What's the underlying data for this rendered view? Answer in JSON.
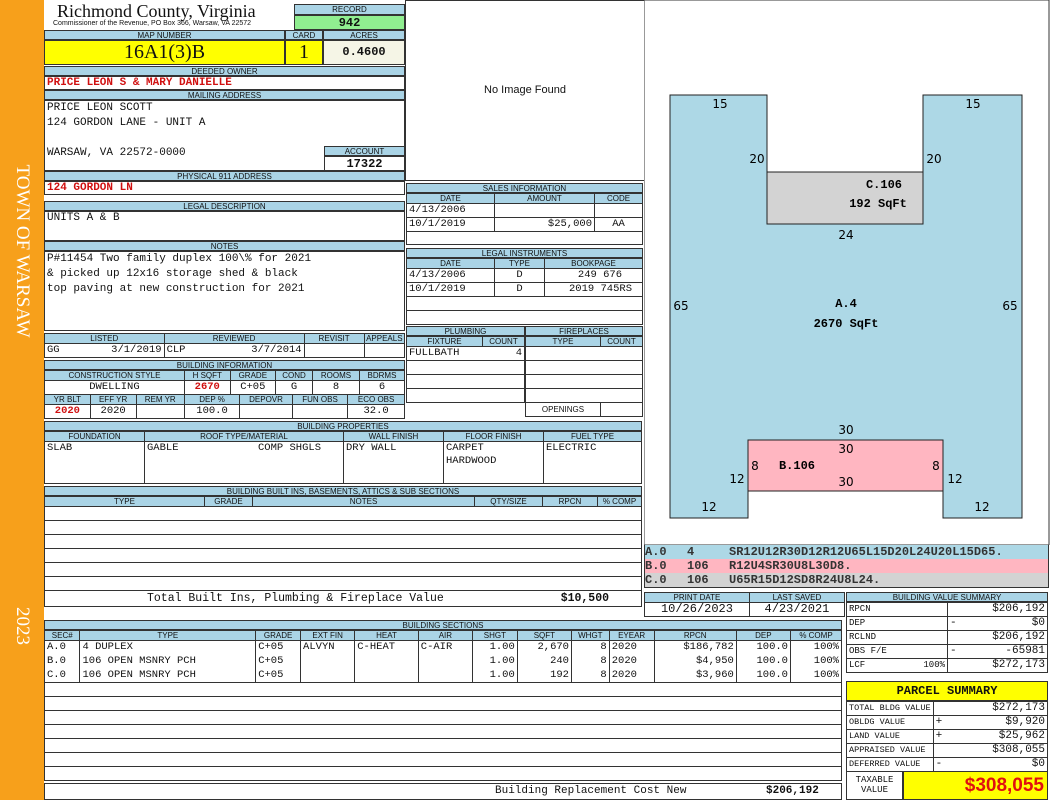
{
  "sidebar": {
    "town": "TOWN OF WARSAW",
    "year": "2023"
  },
  "header": {
    "county": "Richmond County, Virginia",
    "office": "Commissioner of the Revenue, PO Box 366, Warsaw, VA 22572",
    "record_label": "RECORD",
    "record": "942"
  },
  "parcel": {
    "map_label": "MAP NUMBER",
    "map": "16A1(3)B",
    "card_label": "CARD",
    "card": "1",
    "acres_label": "ACRES",
    "acres": "0.4600"
  },
  "owner": {
    "label": "DEEDED OWNER",
    "name": "PRICE LEON S & MARY DANIELLE"
  },
  "mailing": {
    "label": "MAILING ADDRESS",
    "lines": [
      "PRICE LEON SCOTT",
      "124 GORDON LANE - UNIT A",
      "",
      "WARSAW, VA 22572-0000"
    ],
    "account_label": "ACCOUNT",
    "account": "17322"
  },
  "physical": {
    "label": "PHYSICAL 911 ADDRESS",
    "value": "124 GORDON LN"
  },
  "legal": {
    "label": "LEGAL DESCRIPTION",
    "value": "UNITS A & B"
  },
  "notes": {
    "label": "NOTES",
    "lines": [
      "P#11454 Two family duplex 100\\% for 2021",
      "& picked up 12x16 storage shed & black",
      "top paving at new construction for 2021"
    ]
  },
  "listing": {
    "listed_label": "LISTED",
    "listed_by": "GG",
    "listed_date": "3/1/2019",
    "reviewed_label": "REVIEWED",
    "reviewed_by": "CLP",
    "reviewed_date": "3/7/2014",
    "revisit_label": "REVISIT",
    "appeals_label": "APPEALS"
  },
  "building_info": {
    "label": "BUILDING INFORMATION",
    "headers1": [
      "CONSTRUCTION STYLE",
      "H SQFT",
      "GRADE",
      "COND",
      "ROOMS",
      "BDRMS"
    ],
    "values1": [
      "DWELLING",
      "2670",
      "C+05",
      "G",
      "8",
      "6"
    ],
    "headers2": [
      "YR BLT",
      "EFF YR",
      "REM YR",
      "DEP %",
      "DEPOVR",
      "FUN OBS",
      "ECO OBS"
    ],
    "values2": [
      "2020",
      "2020",
      "",
      "100.0",
      "",
      "",
      "32.0"
    ]
  },
  "properties": {
    "label": "BUILDING PROPERTIES",
    "headers": [
      "FOUNDATION",
      "ROOF TYPE/MATERIAL",
      "WALL FINISH",
      "FLOOR FINISH",
      "FUEL TYPE"
    ],
    "foundation": "SLAB",
    "roof_type": "GABLE",
    "roof_material": "COMP SHGLS",
    "wall": "DRY WALL",
    "floor": [
      "CARPET",
      "HARDWOOD"
    ],
    "fuel": "ELECTRIC"
  },
  "builtins": {
    "label": "BUILDING BUILT INS, BASEMENTS, ATTICS & SUB SECTIONS",
    "headers": [
      "TYPE",
      "GRADE",
      "NOTES",
      "QTY/SIZE",
      "RPCN",
      "% COMP"
    ],
    "total_label": "Total Built Ins, Plumbing & Fireplace Value",
    "total": "$10,500"
  },
  "sections": {
    "label": "BUILDING SECTIONS",
    "headers": [
      "SEC#",
      "TYPE",
      "GRADE",
      "EXT FIN",
      "HEAT",
      "AIR",
      "SHGT",
      "SQFT",
      "WHGT",
      "EYEAR",
      "RPCN",
      "DEP",
      "% COMP"
    ],
    "rows": [
      [
        "A.0",
        "4 DUPLEX",
        "C+05",
        "ALVYN",
        "C-HEAT",
        "C-AIR",
        "1.00",
        "2,670",
        "8",
        "2020",
        "$186,782",
        "100.0",
        "100%"
      ],
      [
        "B.0",
        "106 OPEN MSNRY PCH",
        "C+05",
        "",
        "",
        "",
        "1.00",
        "240",
        "8",
        "2020",
        "$4,950",
        "100.0",
        "100%"
      ],
      [
        "C.0",
        "106 OPEN MSNRY PCH",
        "C+05",
        "",
        "",
        "",
        "1.00",
        "192",
        "8",
        "2020",
        "$3,960",
        "100.0",
        "100%"
      ]
    ],
    "total_label": "Building Replacement Cost New",
    "total": "$206,192"
  },
  "image": {
    "placeholder": "No Image Found"
  },
  "sales": {
    "label": "SALES INFORMATION",
    "headers": [
      "DATE",
      "AMOUNT",
      "CODE"
    ],
    "rows": [
      [
        "4/13/2006",
        "",
        ""
      ],
      [
        "10/1/2019",
        "$25,000",
        "AA"
      ]
    ]
  },
  "instruments": {
    "label": "LEGAL INSTRUMENTS",
    "headers": [
      "DATE",
      "TYPE",
      "BOOKPAGE"
    ],
    "rows": [
      [
        "4/13/2006",
        "D",
        "249 676"
      ],
      [
        "10/1/2019",
        "D",
        "2019 745RS"
      ]
    ]
  },
  "plumbing": {
    "label": "PLUMBING",
    "headers": [
      "FIXTURE",
      "COUNT"
    ],
    "rows": [
      [
        "FULLBATH",
        "4"
      ]
    ]
  },
  "fireplaces": {
    "label": "FIREPLACES",
    "headers": [
      "TYPE",
      "COUNT"
    ],
    "openings_label": "OPENINGS"
  },
  "sketch": {
    "a_label": "A.4",
    "a_area": "2670 SqFt",
    "b_label": "B.106",
    "c_label": "C.106",
    "c_area": "192 SqFt",
    "dims": {
      "top_left": "15",
      "top_right": "15",
      "notch_left": "20",
      "notch_right": "20",
      "notch_bottom": "24",
      "left": "65",
      "right": "65",
      "b_top_outer": "30",
      "b_top": "30",
      "b_bottom": "30",
      "b_left": "8",
      "b_right": "8",
      "leg_left": "12",
      "leg_right": "12",
      "foot_left": "12",
      "foot_right": "12"
    },
    "segments": [
      {
        "sec": "A.0",
        "code": "4",
        "path": "SR12U12R30D12R12U65L15D20L24U20L15D65.",
        "color": "#add8e6"
      },
      {
        "sec": "B.0",
        "code": "106",
        "path": "R12U4SR30U8L30D8.",
        "color": "#ffb6c1"
      },
      {
        "sec": "C.0",
        "code": "106",
        "path": "U65R15D12SD8R24U8L24.",
        "color": "#d3d3d3"
      }
    ]
  },
  "dates": {
    "print_label": "PRINT DATE",
    "print": "10/26/2023",
    "saved_label": "LAST SAVED",
    "saved": "4/23/2021"
  },
  "value_summary": {
    "label": "BUILDING VALUE SUMMARY",
    "rows": [
      {
        "label": "RPCN",
        "sign": "",
        "value": "$206,192"
      },
      {
        "label": "DEP",
        "sign": "-",
        "value": "$0"
      },
      {
        "label": "RCLND",
        "sign": "",
        "value": "$206,192"
      },
      {
        "label": "OBS F/E",
        "sign": "-",
        "value": "-65981"
      },
      {
        "label": "LCF",
        "pct": "100%",
        "sign": "",
        "value": "$272,173"
      }
    ]
  },
  "parcel_summary": {
    "label": "PARCEL SUMMARY",
    "rows": [
      {
        "label": "TOTAL BLDG VALUE",
        "sign": "",
        "value": "$272,173"
      },
      {
        "label": "OBLDG VALUE",
        "sign": "+",
        "value": "$9,920"
      },
      {
        "label": "LAND VALUE",
        "sign": "+",
        "value": "$25,962"
      },
      {
        "label": "APPRAISED VALUE",
        "sign": "",
        "value": "$308,055"
      },
      {
        "label": "DEFERRED VALUE",
        "sign": "-",
        "value": "$0"
      }
    ],
    "taxable_label": "TAXABLE VALUE",
    "taxable": "$308,055"
  }
}
